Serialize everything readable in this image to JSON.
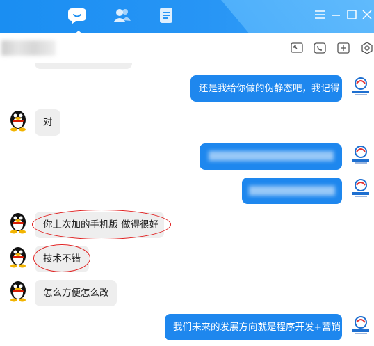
{
  "titlebar": {
    "nav": [
      {
        "name": "chat-bubble-icon",
        "active": true
      },
      {
        "name": "contacts-icon",
        "active": false
      },
      {
        "name": "document-icon",
        "active": false
      }
    ],
    "window_buttons": [
      "menu-icon",
      "minimize-icon",
      "maximize-icon",
      "close-icon"
    ]
  },
  "toolbar": {
    "tools": [
      "screenshot-icon",
      "phone-icon",
      "add-icon",
      "settings-icon"
    ]
  },
  "colors": {
    "accent": "#1e87ee",
    "incoming_bubble": "#eeeeee",
    "highlight_ellipse": "#e02020"
  },
  "messages": [
    {
      "side": "out",
      "text": "还是我给你做的伪静态吧，我记得"
    },
    {
      "side": "in",
      "text": "对"
    },
    {
      "side": "out",
      "text": ""
    },
    {
      "side": "out",
      "text": ""
    },
    {
      "side": "in",
      "text": "你上次加的手机版 做得很好",
      "highlighted": true
    },
    {
      "side": "in",
      "text": "技术不错",
      "highlighted": true
    },
    {
      "side": "in",
      "text": "怎么方便怎么改"
    },
    {
      "side": "out",
      "text": "我们未来的发展方向就是程序开发+营销"
    }
  ]
}
